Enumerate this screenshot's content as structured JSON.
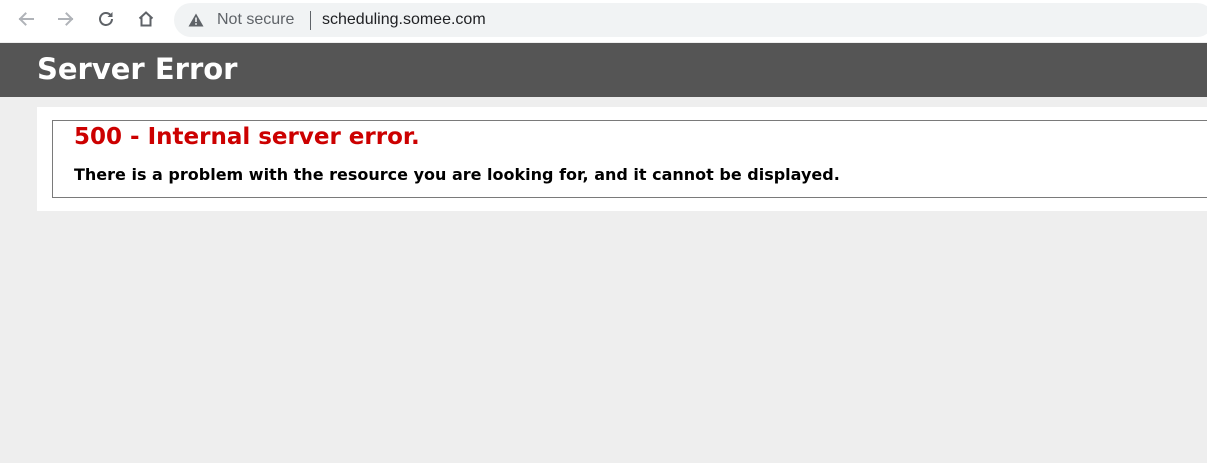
{
  "browser": {
    "security_label": "Not secure",
    "url": "scheduling.somee.com",
    "icons": [
      "back-arrow-icon",
      "forward-arrow-icon",
      "reload-icon",
      "home-icon",
      "warning-triangle-icon"
    ]
  },
  "page": {
    "header_title": "Server Error",
    "error_title": "500 - Internal server error.",
    "error_message": "There is a problem with the resource you are looking for, and it cannot be displayed."
  },
  "colors": {
    "header_bg": "#555555",
    "error_title": "#cc0000",
    "page_bg": "#eeeeee"
  }
}
